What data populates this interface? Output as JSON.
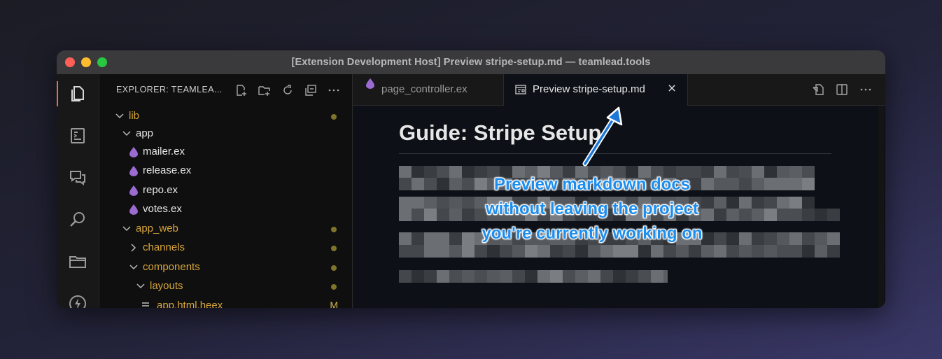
{
  "window": {
    "title": "[Extension Development Host] Preview stripe-setup.md — teamlead.tools"
  },
  "activity_bar": {
    "items": [
      {
        "icon": "files-icon",
        "active": true
      },
      {
        "icon": "preview-doc-icon"
      },
      {
        "icon": "comment-discussion-icon"
      },
      {
        "icon": "search-icon"
      },
      {
        "icon": "folder-icon"
      },
      {
        "icon": "lightning-icon"
      }
    ]
  },
  "sidebar": {
    "title": "EXPLORER: TEAMLEA...",
    "actions": [
      "new-file-icon",
      "new-folder-icon",
      "refresh-icon",
      "collapse-all-icon",
      "more-icon"
    ],
    "tree": [
      {
        "label": "lib",
        "type": "folder",
        "expanded": true,
        "indent": 0,
        "color": "#d6a53b",
        "dot": true
      },
      {
        "label": "app",
        "type": "folder",
        "expanded": true,
        "indent": 1,
        "color": "#e6e6e6",
        "dot": false
      },
      {
        "label": "mailer.ex",
        "type": "file",
        "indent": 2,
        "color": "#e6e6e6"
      },
      {
        "label": "release.ex",
        "type": "file",
        "indent": 2,
        "color": "#e6e6e6"
      },
      {
        "label": "repo.ex",
        "type": "file",
        "indent": 2,
        "color": "#e6e6e6"
      },
      {
        "label": "votes.ex",
        "type": "file",
        "indent": 2,
        "color": "#e6e6e6"
      },
      {
        "label": "app_web",
        "type": "folder",
        "expanded": true,
        "indent": 1,
        "color": "#d6a53b",
        "dot": true
      },
      {
        "label": "channels",
        "type": "folder",
        "expanded": false,
        "indent": 2,
        "color": "#d6a53b",
        "dot": true
      },
      {
        "label": "components",
        "type": "folder",
        "expanded": true,
        "indent": 2,
        "color": "#d6a53b",
        "dot": true
      },
      {
        "label": "layouts",
        "type": "folder",
        "expanded": true,
        "indent": 3,
        "color": "#d6a53b",
        "dot": true
      },
      {
        "label": "app.html.heex",
        "type": "file-lines",
        "indent": 4,
        "color": "#d6a53b",
        "badge": "M"
      }
    ]
  },
  "tabs": [
    {
      "label": "page_controller.ex",
      "icon": "elixir-drop-icon",
      "active": false
    },
    {
      "label": "Preview stripe-setup.md",
      "icon": "preview-icon",
      "active": true,
      "close": "×"
    }
  ],
  "editor_actions": [
    "open-source-icon",
    "split-editor-icon",
    "more-icon"
  ],
  "document": {
    "heading": "Guide: Stripe Setup"
  },
  "annotation": {
    "line1": "Preview markdown docs",
    "line2": "without leaving the project",
    "line3": "you're currently working on"
  }
}
